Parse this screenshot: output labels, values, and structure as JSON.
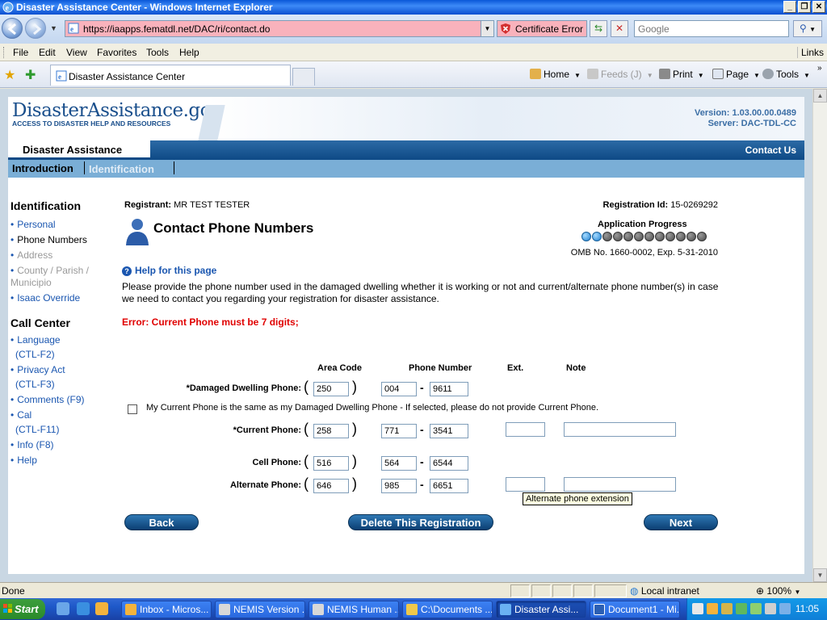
{
  "window": {
    "title": "Disaster Assistance Center - Windows Internet Explorer"
  },
  "address_bar": {
    "url": "https://iaapps.fematdl.net/DAC/ri/contact.do",
    "certificate_error": "Certificate Error",
    "search_placeholder": "Google"
  },
  "menu": {
    "items": [
      "File",
      "Edit",
      "View",
      "Favorites",
      "Tools",
      "Help"
    ],
    "links": "Links"
  },
  "tabs": {
    "active_tab": "Disaster Assistance Center"
  },
  "command_bar": {
    "home": "Home",
    "feeds": "Feeds (J)",
    "print": "Print",
    "page": "Page",
    "tools": "Tools"
  },
  "site": {
    "logo_main": "DisasterAssistance",
    "logo_gov": ".gov",
    "logo_tagline": "ACCESS TO DISASTER HELP AND RESOURCES",
    "version": "Version: 1.03.00.00.0489",
    "server": "Server: DAC-TDL-CC",
    "section_tab": "Disaster Assistance",
    "contact_us": "Contact Us",
    "subnav": {
      "introduction": "Introduction",
      "identification": "Identification"
    }
  },
  "sidebar": {
    "identification_heading": "Identification",
    "identification_items": [
      {
        "label": "Personal",
        "state": "link"
      },
      {
        "label": "Phone Numbers",
        "state": "current"
      },
      {
        "label": "Address",
        "state": "disabled"
      },
      {
        "label": "County / Parish /",
        "state": "disabled"
      },
      {
        "label": "Municipio",
        "state": "disabled"
      },
      {
        "label": "Isaac Override",
        "state": "link"
      }
    ],
    "callcenter_heading": "Call Center",
    "callcenter_items": [
      {
        "label": "Language"
      },
      {
        "label": "(CTL-F2)"
      },
      {
        "label": "Privacy Act"
      },
      {
        "label": "(CTL-F3)"
      },
      {
        "label": "Comments (F9)"
      },
      {
        "label": "Cal"
      },
      {
        "label": "(CTL-F11)"
      },
      {
        "label": "Info (F8)"
      },
      {
        "label": "Help"
      }
    ]
  },
  "main": {
    "registrant_label": "Registrant:",
    "registrant_value": "MR TEST TESTER",
    "registration_id_label": "Registration Id:",
    "registration_id_value": "15-0269292",
    "title": "Contact Phone Numbers",
    "progress_label": "Application Progress",
    "progress_total": 12,
    "progress_done": 2,
    "omb": "OMB No. 1660-0002, Exp. 5-31-2010",
    "help_link": "Help for this page",
    "instructions": "Please provide the phone number used in the damaged dwelling whether it is working or not and current/alternate phone number(s) in case we need to contact you regarding your registration for disaster assistance.",
    "error": "Error: Current Phone must be 7 digits;",
    "columns": {
      "area_code": "Area Code",
      "phone_number": "Phone Number",
      "ext": "Ext.",
      "note": "Note"
    },
    "phones": {
      "damaged": {
        "label": "*Damaged Dwelling Phone:",
        "area": "250",
        "prefix": "004",
        "line": "9611"
      },
      "current": {
        "label": "*Current Phone:",
        "area": "258",
        "prefix": "771",
        "line": "3541",
        "ext": "",
        "note": ""
      },
      "cell": {
        "label": "Cell Phone:",
        "area": "516",
        "prefix": "564",
        "line": "6544"
      },
      "alternate": {
        "label": "Alternate Phone:",
        "area": "646",
        "prefix": "985",
        "line": "6651",
        "ext": "",
        "note": ""
      }
    },
    "same_as_checkbox": "My Current Phone is the same as my Damaged Dwelling Phone - If selected, please do not provide Current Phone.",
    "tooltip": "Alternate phone extension",
    "buttons": {
      "back": "Back",
      "delete": "Delete This Registration",
      "next": "Next"
    }
  },
  "statusbar": {
    "status": "Done",
    "zone": "Local intranet",
    "zoom": "100%"
  },
  "taskbar": {
    "start": "Start",
    "tasks": [
      {
        "label": "Inbox - Micros..."
      },
      {
        "label": "NEMIS Version ..."
      },
      {
        "label": "NEMIS Human ..."
      },
      {
        "label": "C:\\Documents ..."
      },
      {
        "label": "Disaster Assi..."
      },
      {
        "label": "Document1 - Mi..."
      }
    ],
    "clock": "11:05"
  },
  "colors": {
    "brand_blue": "#0e4a86",
    "error_red": "#e00000",
    "link_blue": "#1a56b0",
    "cert_error_pink": "#f9b2bc"
  }
}
